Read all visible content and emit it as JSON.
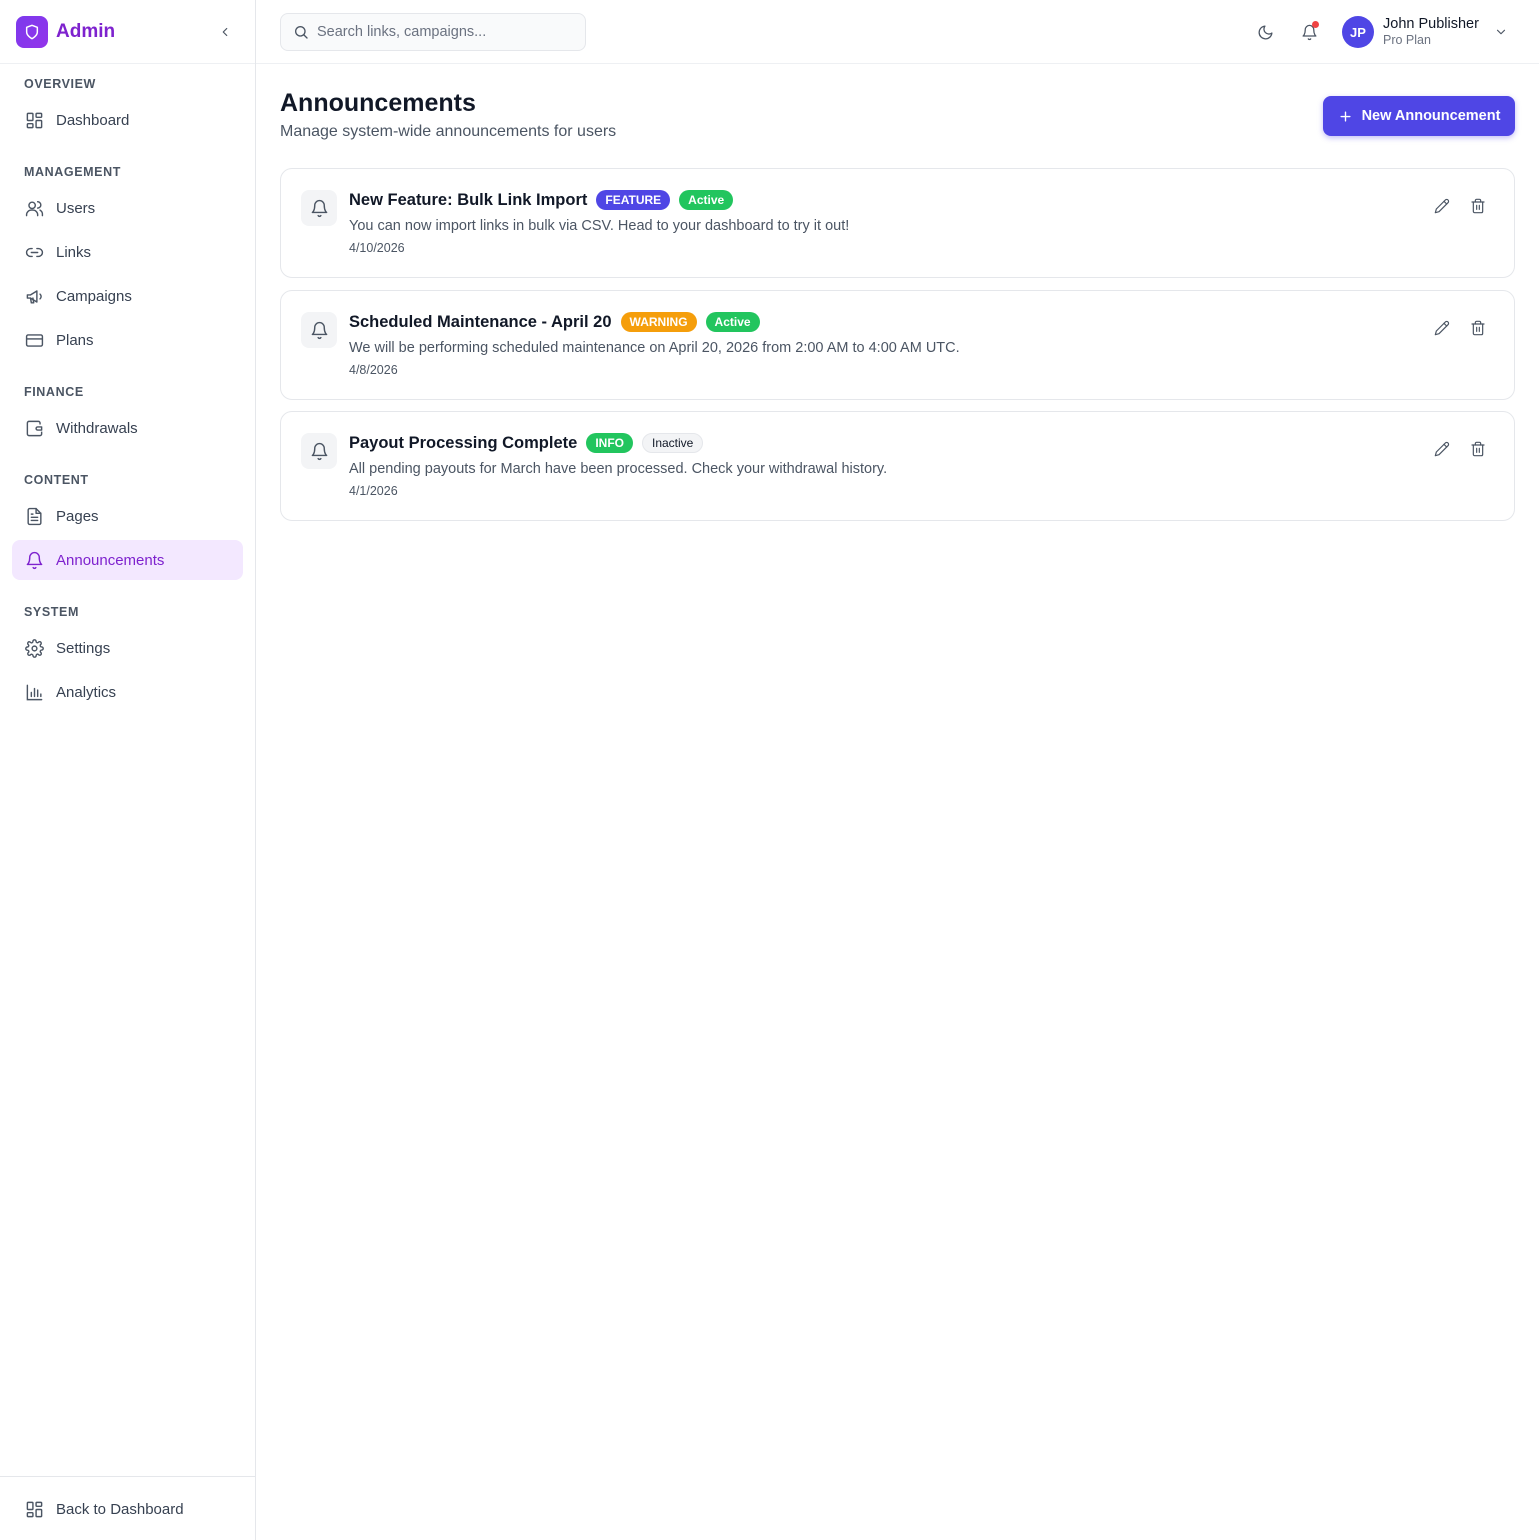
{
  "brand": {
    "name": "Admin",
    "color": "#7e22ce"
  },
  "search": {
    "placeholder": "Search links, campaigns..."
  },
  "user": {
    "initials": "JP",
    "name": "John Publisher",
    "plan": "Pro Plan"
  },
  "sidebar": {
    "sections": [
      {
        "label": "OVERVIEW",
        "items": [
          {
            "label": "Dashboard",
            "icon": "dashboard-icon"
          }
        ]
      },
      {
        "label": "MANAGEMENT",
        "items": [
          {
            "label": "Users",
            "icon": "users-icon"
          },
          {
            "label": "Links",
            "icon": "link-icon"
          },
          {
            "label": "Campaigns",
            "icon": "megaphone-icon"
          },
          {
            "label": "Plans",
            "icon": "credit-card-icon"
          }
        ]
      },
      {
        "label": "FINANCE",
        "items": [
          {
            "label": "Withdrawals",
            "icon": "wallet-icon"
          }
        ]
      },
      {
        "label": "CONTENT",
        "items": [
          {
            "label": "Pages",
            "icon": "file-text-icon"
          },
          {
            "label": "Announcements",
            "icon": "bell-icon",
            "active": true
          }
        ]
      },
      {
        "label": "SYSTEM",
        "items": [
          {
            "label": "Settings",
            "icon": "gear-icon"
          },
          {
            "label": "Analytics",
            "icon": "bar-chart-icon"
          }
        ]
      }
    ],
    "footer_label": "Back to Dashboard"
  },
  "page": {
    "title": "Announcements",
    "subtitle": "Manage system-wide announcements for users",
    "new_button": "New Announcement"
  },
  "announcements": [
    {
      "title": "New Feature: Bulk Link Import",
      "type": "FEATURE",
      "type_color": "#4f46e5",
      "status": "Active",
      "status_color": "#22c55e",
      "description": "You can now import links in bulk via CSV. Head to your dashboard to try it out!",
      "date": "4/10/2026"
    },
    {
      "title": "Scheduled Maintenance - April 20",
      "type": "WARNING",
      "type_color": "#f59e0b",
      "status": "Active",
      "status_color": "#22c55e",
      "description": "We will be performing scheduled maintenance on April 20, 2026 from 2:00 AM to 4:00 AM UTC.",
      "date": "4/8/2026"
    },
    {
      "title": "Payout Processing Complete",
      "type": "INFO",
      "type_color": "#22c55e",
      "status": "Inactive",
      "status_color": "#f3f4f6",
      "description": "All pending payouts for March have been processed. Check your withdrawal history.",
      "date": "4/1/2026"
    }
  ]
}
